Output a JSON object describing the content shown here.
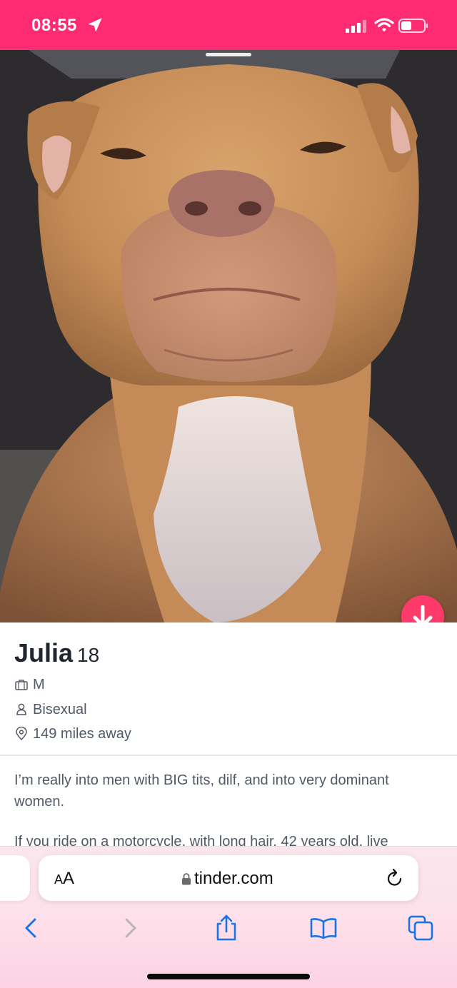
{
  "status_bar": {
    "time": "08:55",
    "background_color": "#fe2a72",
    "icons": [
      "location-arrow-icon",
      "cellular-signal-icon",
      "wifi-icon",
      "battery-icon"
    ]
  },
  "profile": {
    "name": "Julia",
    "age": "18",
    "details": [
      {
        "icon": "briefcase-icon",
        "text": "M"
      },
      {
        "icon": "person-icon",
        "text": "Bisexual"
      },
      {
        "icon": "map-pin-icon",
        "text": "149 miles away"
      }
    ],
    "bio": [
      "I’m really into men with BIG tits, dilf, and into very dominant women.",
      "If you ride on a motorcycle, with long hair, 42 years old, live"
    ],
    "scroll_button_icon": "arrow-down-icon",
    "accent_color": "#fd3a6a"
  },
  "browser": {
    "reader_label_big": "A",
    "reader_label_small": "A",
    "url": "tinder.com",
    "toolbar_icons": [
      "back-chevron-icon",
      "forward-chevron-icon",
      "share-icon",
      "bookmarks-icon",
      "tabs-icon"
    ],
    "accent_color": "#1a73e8"
  }
}
